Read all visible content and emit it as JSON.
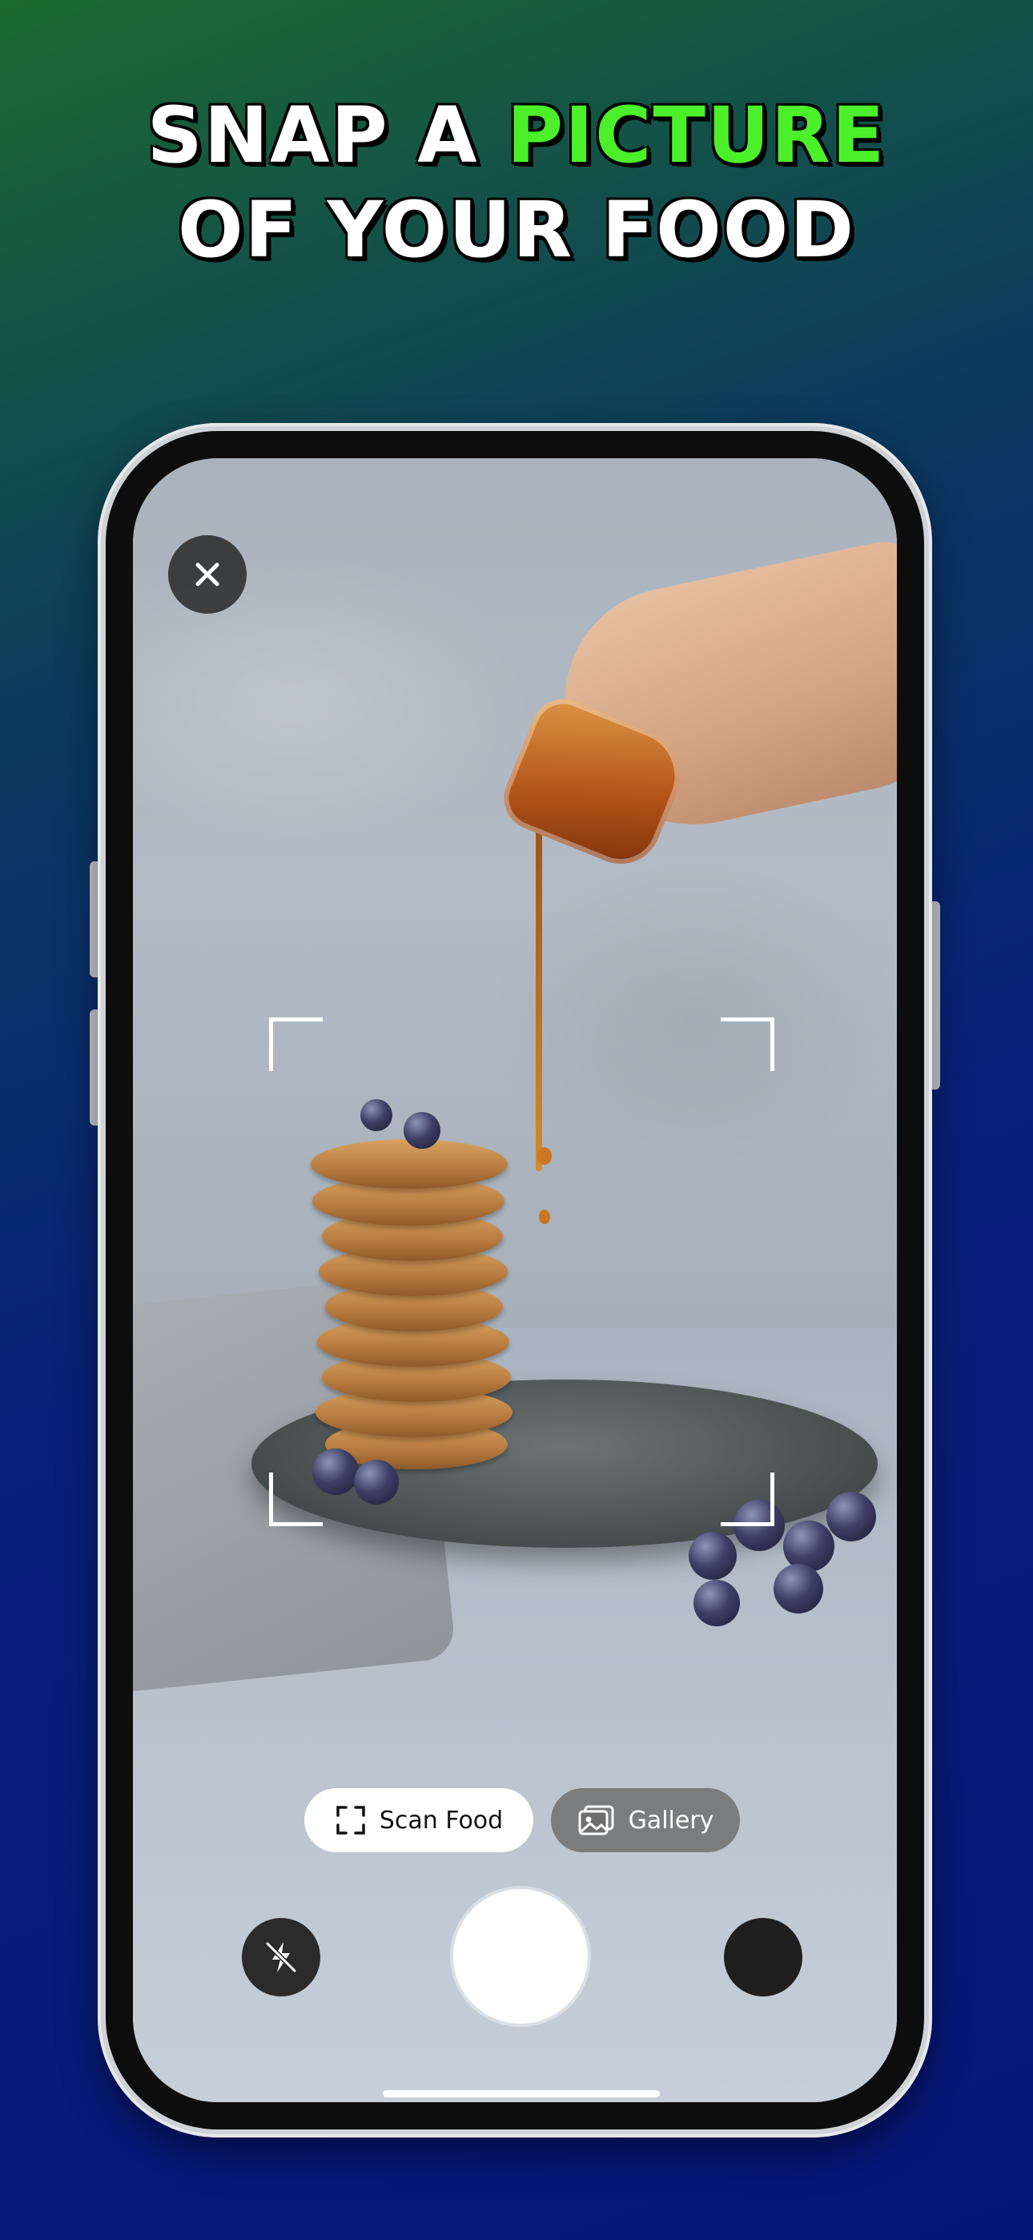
{
  "headline": {
    "line1_prefix": "SNAP A ",
    "line1_accent": "PICTURE",
    "line2": "OF YOUR FOOD"
  },
  "colors": {
    "accent": "#4bf02a",
    "headline_text": "#ffffff",
    "background_top": "#1b6a30",
    "background_bottom": "#07157a"
  },
  "camera": {
    "close_icon": "close-icon",
    "modes": [
      {
        "label": "Scan Food",
        "icon": "scan-frame-icon",
        "selected": true
      },
      {
        "label": "Gallery",
        "icon": "gallery-image-icon",
        "selected": false
      }
    ],
    "flash_icon": "flash-off-icon",
    "shutter": "shutter-button",
    "lens": "camera-switch-button"
  }
}
